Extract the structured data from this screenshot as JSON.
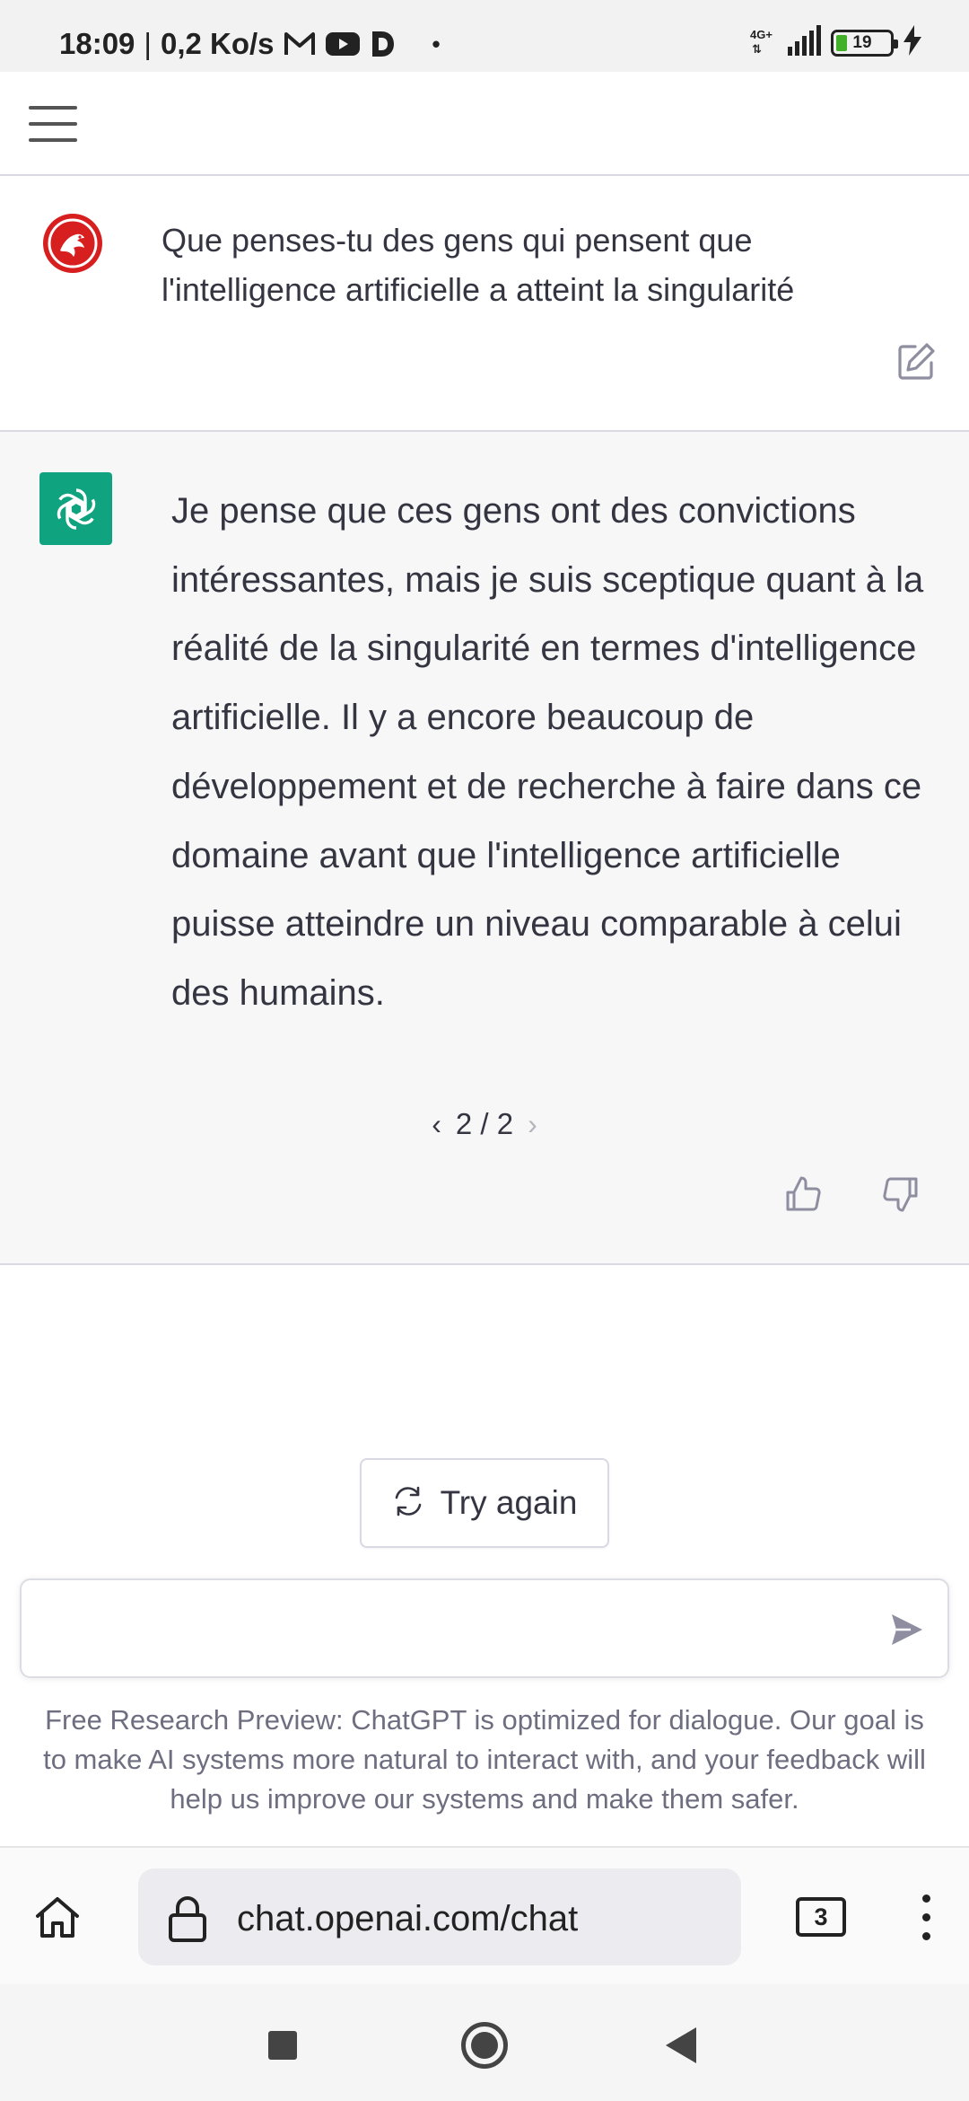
{
  "status_bar": {
    "time": "18:09",
    "separator": "|",
    "speed": "0,2 Ko/s",
    "dot": "•",
    "network_type": "4G+",
    "battery_level": "19",
    "icons": [
      "gmail-icon",
      "youtube-icon",
      "d-app-icon",
      "signal-icon",
      "battery-icon",
      "charging-icon"
    ]
  },
  "topnav": {
    "menu_icon": "hamburger-menu-icon"
  },
  "conversation": {
    "user_message": "Que penses-tu des gens qui pensent que l'intelligence artificielle a atteint la singularité",
    "assistant_message": "Je pense que ces gens ont des convictions intéressantes, mais je suis sceptique quant à la réalité de la singularité en termes d'intelligence artificielle. Il y a encore beaucoup de développement et de recherche à faire dans ce domaine avant que l'intelligence artificielle puisse atteindre un niveau comparable à celui des humains.",
    "pager": {
      "prev": "‹",
      "label": "2 / 2",
      "next": "›"
    }
  },
  "actions": {
    "try_again_label": "Try again"
  },
  "input": {
    "value": "",
    "placeholder": ""
  },
  "disclaimer": "Free Research Preview: ChatGPT is optimized for dialogue. Our goal is to make AI systems more natural to interact with, and your feedback will help us improve our systems and make them safer.",
  "browser": {
    "url": "chat.openai.com/chat",
    "tab_count": "3"
  },
  "colors": {
    "openai_green": "#10a37f",
    "user_avatar_red": "#d81f1f",
    "assistant_bg": "#f7f7f8",
    "text": "#343541",
    "muted": "#6e6e80"
  }
}
